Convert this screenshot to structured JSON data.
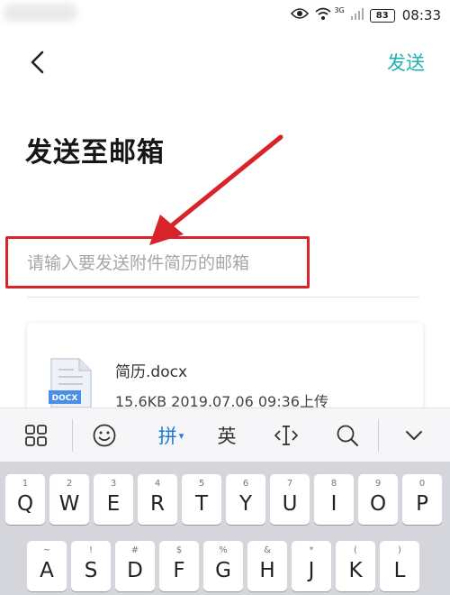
{
  "status_bar": {
    "network_label": "3G",
    "battery_level": "83",
    "time": "08:33",
    "icons": [
      "eye-icon",
      "wifi-icon",
      "signal-icon",
      "battery-icon"
    ]
  },
  "header": {
    "back_icon": "chevron-left-icon",
    "send_label": "发送"
  },
  "page": {
    "title": "发送至邮箱"
  },
  "email_input": {
    "value": "",
    "placeholder": "请输入要发送附件简历的邮箱"
  },
  "attachment": {
    "icon_label": "DOCX",
    "file_name": "简历.docx",
    "meta": "15.6KB 2019.07.06 09:36上传"
  },
  "keyboard_toolbar": {
    "pinyin_label": "拼",
    "pinyin_caret": "▾",
    "english_label": "英",
    "icons": [
      "grid-menu-icon",
      "emoji-icon",
      "cursor-move-icon",
      "search-icon",
      "collapse-keyboard-icon"
    ]
  },
  "keyboard": {
    "row1": [
      {
        "sub": "1",
        "main": "Q"
      },
      {
        "sub": "2",
        "main": "W"
      },
      {
        "sub": "3",
        "main": "E"
      },
      {
        "sub": "4",
        "main": "R"
      },
      {
        "sub": "5",
        "main": "T"
      },
      {
        "sub": "6",
        "main": "Y"
      },
      {
        "sub": "7",
        "main": "U"
      },
      {
        "sub": "8",
        "main": "I"
      },
      {
        "sub": "9",
        "main": "O"
      },
      {
        "sub": "0",
        "main": "P"
      }
    ],
    "row2": [
      {
        "sub": "~",
        "main": "A"
      },
      {
        "sub": "!",
        "main": "S"
      },
      {
        "sub": "#",
        "main": "D"
      },
      {
        "sub": "$",
        "main": "F"
      },
      {
        "sub": "%",
        "main": "G"
      },
      {
        "sub": "&",
        "main": "H"
      },
      {
        "sub": "*",
        "main": "J"
      },
      {
        "sub": "(",
        "main": "K"
      },
      {
        "sub": ")",
        "main": "L"
      }
    ]
  },
  "colors": {
    "accent": "#1fb0b3",
    "highlight": "#d8232a",
    "pinyin_active": "#1d7ad8"
  }
}
